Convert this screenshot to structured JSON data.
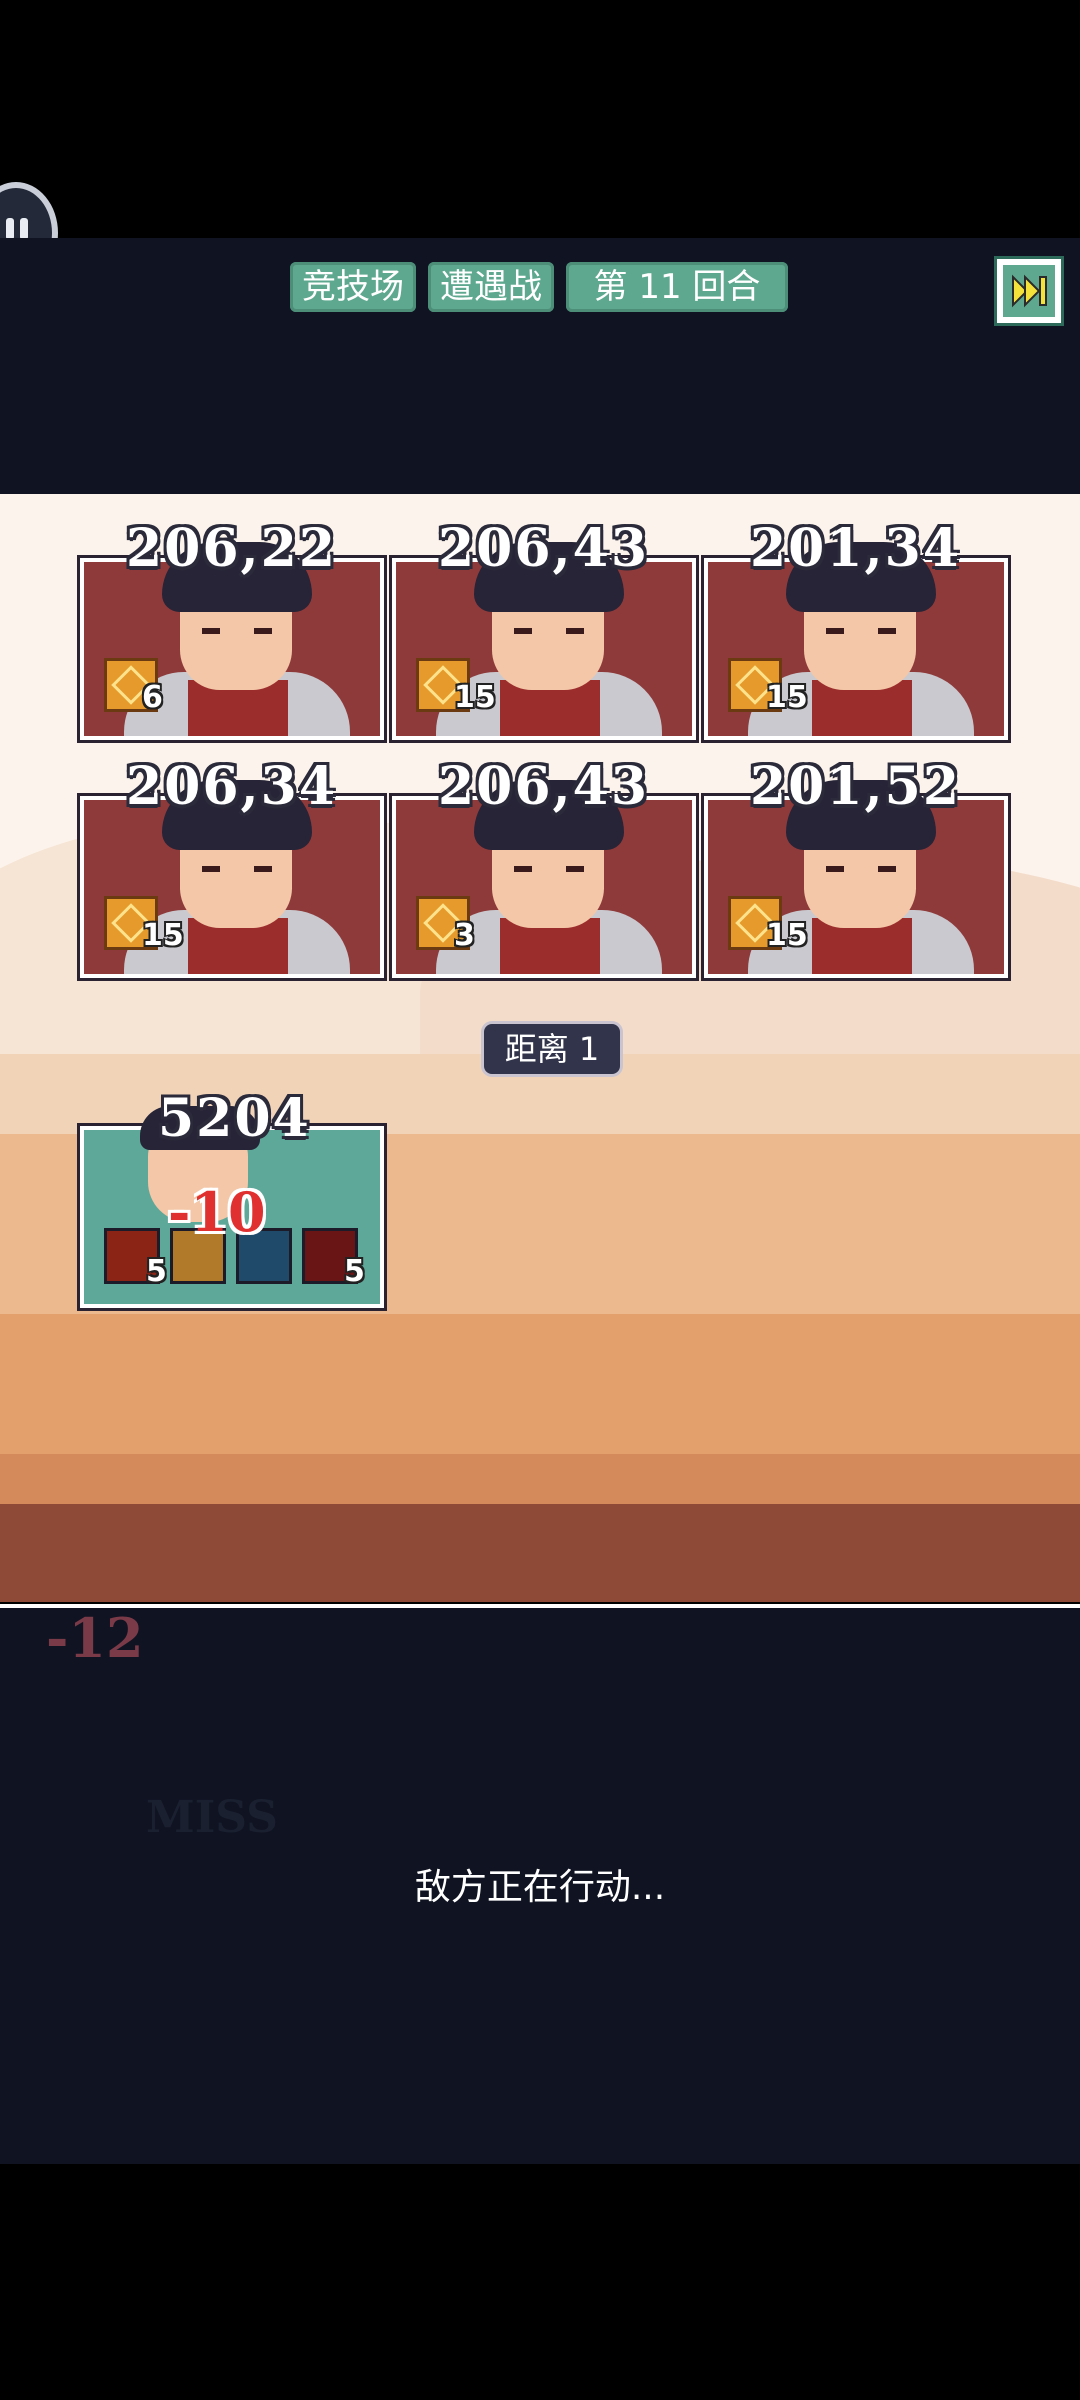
{
  "header": {
    "tags": [
      "竞技场",
      "遭遇战",
      "第 11 回合"
    ],
    "fast_forward_icon": "fast-forward-icon",
    "pause_icon": "pause-icon"
  },
  "enemies": [
    {
      "hp": "206,22",
      "buff_count": "6"
    },
    {
      "hp": "206,43",
      "buff_count": "15"
    },
    {
      "hp": "201,34",
      "buff_count": "15"
    },
    {
      "hp": "206,34",
      "buff_count": "15"
    },
    {
      "hp": "206,43",
      "buff_count": "3"
    },
    {
      "hp": "201,52",
      "buff_count": "15"
    }
  ],
  "distance": "距离 1",
  "hero": {
    "hp": "5204",
    "damage": "-10",
    "items": [
      {
        "icon": "red-gem-icon",
        "count": "5"
      },
      {
        "icon": "gold-star-icon",
        "count": ""
      },
      {
        "icon": "blue-swirl-icon",
        "count": ""
      },
      {
        "icon": "red-note-icon",
        "count": "5"
      }
    ]
  },
  "log": {
    "damage": "-12",
    "miss": "MISS",
    "status": "敌方正在行动..."
  },
  "colors": {
    "tag_bg": "#5ea88f",
    "panel_bg": "#0f1322",
    "enemy_card": "#8f3a3a",
    "hero_card": "#5ea89a"
  }
}
